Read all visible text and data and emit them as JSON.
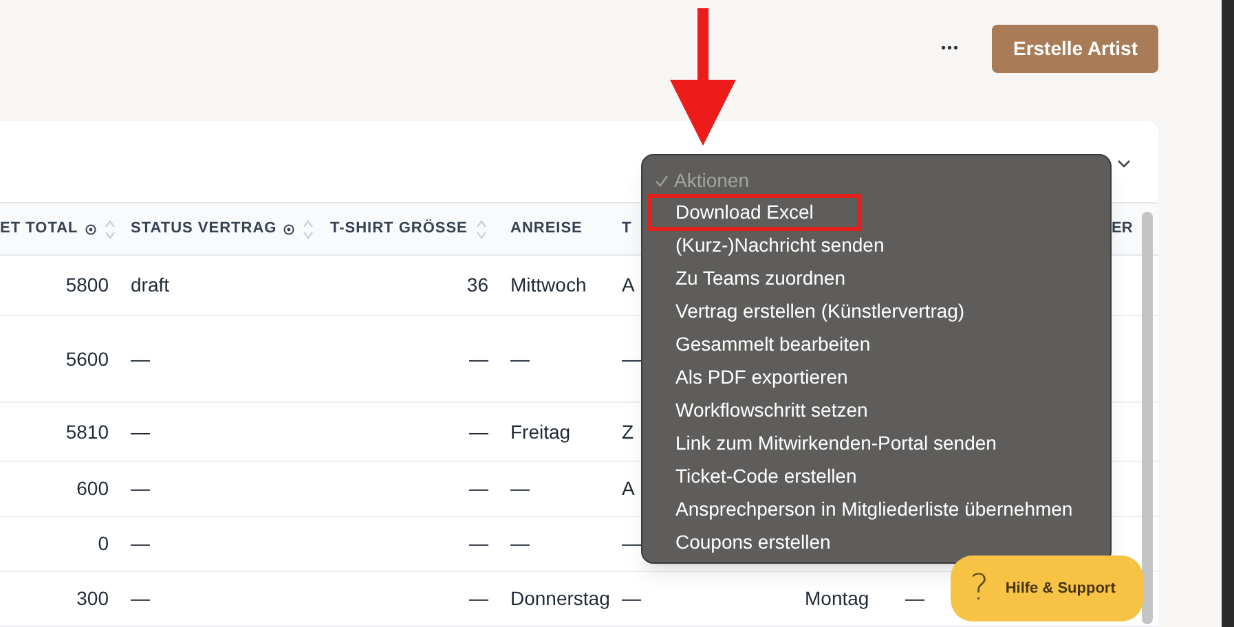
{
  "header": {
    "more_button": "•••",
    "create_button": "Erstelle Artist"
  },
  "table": {
    "columns": [
      {
        "label": "ET TOTAL",
        "info": true,
        "sortable": true
      },
      {
        "label": "STATUS VERTRAG",
        "info": true,
        "sortable": true
      },
      {
        "label": "T-SHIRT GRÖSSE",
        "info": false,
        "sortable": true
      },
      {
        "label": "ANREISE",
        "info": false,
        "sortable": false
      },
      {
        "label": "T",
        "info": false,
        "sortable": false
      }
    ],
    "clipped_header": "ER",
    "rows": [
      {
        "cells": [
          "5800",
          "draft",
          "36",
          "Mittwoch",
          "A"
        ]
      },
      {
        "cells": [
          "5600",
          "—",
          "—",
          "—",
          "—"
        ]
      },
      {
        "cells": [
          "5810",
          "—",
          "—",
          "Freitag",
          "Z"
        ]
      },
      {
        "cells": [
          "600",
          "—",
          "—",
          "—",
          "A"
        ]
      },
      {
        "cells": [
          "0",
          "—",
          "—",
          "—",
          "—"
        ]
      },
      {
        "cells": [
          "300",
          "—",
          "—",
          "Donnerstag",
          "—",
          "Montag",
          "—"
        ]
      }
    ]
  },
  "actions_menu": {
    "title": "Aktionen",
    "title_checked": true,
    "items": [
      {
        "label": "Download Excel",
        "annotated": true
      },
      {
        "label": "(Kurz-)Nachricht senden",
        "annotated": false
      },
      {
        "label": "Zu Teams zuordnen",
        "annotated": false
      },
      {
        "label": "Vertrag erstellen (Künstlervertrag)",
        "annotated": false
      },
      {
        "label": "Gesammelt bearbeiten",
        "annotated": false
      },
      {
        "label": "Als PDF exportieren",
        "annotated": false
      },
      {
        "label": "Workflowschritt setzen",
        "annotated": false
      },
      {
        "label": "Link zum Mitwirkenden-Portal senden",
        "annotated": false
      },
      {
        "label": "Ticket-Code erstellen",
        "annotated": false
      },
      {
        "label": "Ansprechperson in Mitgliederliste übernehmen",
        "annotated": false
      },
      {
        "label": "Coupons erstellen",
        "annotated": false
      }
    ]
  },
  "help_button": {
    "icon": "?",
    "label": "Hilfe & Support"
  }
}
